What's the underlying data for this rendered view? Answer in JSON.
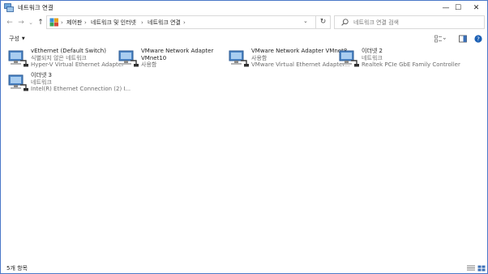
{
  "window": {
    "title": "네트워크 연결",
    "minimize": "—",
    "maximize": "☐",
    "close": "✕"
  },
  "nav": {
    "back": "←",
    "forward": "→",
    "recent": "⌄",
    "up": "↑"
  },
  "breadcrumbs": [
    "제어판",
    "네트워크 및 인터넷",
    "네트워크 연결"
  ],
  "breadcrumb_separator": "›",
  "address_dropdown": "⌄",
  "refresh": "↻",
  "search": {
    "placeholder": "네트워크 연결 검색"
  },
  "command_bar": {
    "organize": "구성"
  },
  "items": [
    {
      "name": "vEthernet (Default Switch)",
      "status": "식별되지 않은 네트워크",
      "adapter": "Hyper-V Virtual Ethernet Adapter"
    },
    {
      "name": "VMware Network Adapter",
      "name2": "VMnet10",
      "status": "사용함",
      "adapter": ""
    },
    {
      "name": "VMware Network Adapter VMnet8",
      "status": "사용함",
      "adapter": "VMware Virtual Ethernet Adapter..."
    },
    {
      "name": "이더넷 2",
      "status": "네트워크",
      "adapter": "Realtek PCIe GbE Family Controller"
    },
    {
      "name": "이더넷 3",
      "status": "네트워크",
      "adapter": "Intel(R) Ethernet Connection (2) I..."
    }
  ],
  "status_bar": {
    "count": "5개 항목"
  },
  "colors": {
    "accent": "#4a78c8",
    "help": "#1a5fb4",
    "secondary_text": "#6d6d6d"
  }
}
